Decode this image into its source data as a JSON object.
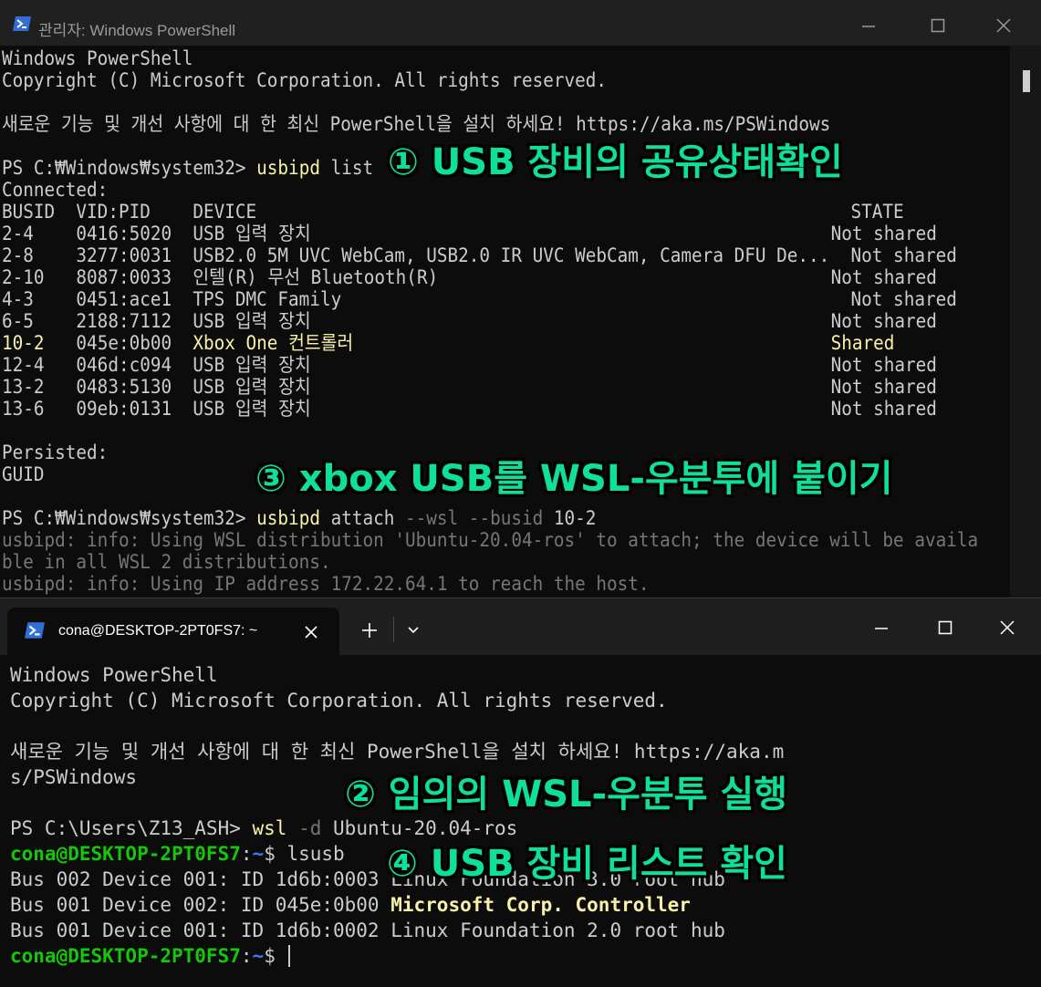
{
  "window1": {
    "title": "관리자: Windows PowerShell",
    "lines": [
      [
        {
          "t": "Windows PowerShell"
        }
      ],
      [
        {
          "t": "Copyright (C) Microsoft Corporation. All rights reserved."
        }
      ],
      [
        {
          "t": ""
        }
      ],
      [
        {
          "t": "새로운 기능 및 개선 사항에 대 한 최신 PowerShell을 설치 하세요! https://aka.ms/PSWindows"
        }
      ],
      [
        {
          "t": ""
        }
      ],
      [
        {
          "t": "PS C:₩Windows₩system32> "
        },
        {
          "t": "usbipd",
          "c": "yl"
        },
        {
          "t": " list"
        }
      ],
      [
        {
          "t": "Connected:"
        }
      ],
      [
        {
          "t": "BUSID  VID:PID    DEVICE                                                        STATE"
        }
      ],
      [
        {
          "t": "2-4    0416:5020  USB 입력 장치                                                 Not shared"
        }
      ],
      [
        {
          "t": "2-8    3277:0031  USB2.0 5M UVC WebCam, USB2.0 IR UVC WebCam, Camera DFU De...  Not shared"
        }
      ],
      [
        {
          "t": "2-10   8087:0033  인텔(R) 무선 Bluetooth(R)                                     Not shared"
        }
      ],
      [
        {
          "t": "4-3    0451:ace1  TPS DMC Family                                                Not shared"
        }
      ],
      [
        {
          "t": "6-5    2188:7112  USB 입력 장치                                                 Not shared"
        }
      ],
      [
        {
          "t": "10-2",
          "c": "yl"
        },
        {
          "t": "   045e:0b00  "
        },
        {
          "t": "Xbox One 컨트롤러                                             ",
          "c": "yl"
        },
        {
          "t": "Shared",
          "c": "yl"
        }
      ],
      [
        {
          "t": "12-4   046d:c094  USB 입력 장치                                                 Not shared"
        }
      ],
      [
        {
          "t": "13-2   0483:5130  USB 입력 장치                                                 Not shared"
        }
      ],
      [
        {
          "t": "13-6   09eb:0131  USB 입력 장치                                                 Not shared"
        }
      ],
      [
        {
          "t": ""
        }
      ],
      [
        {
          "t": "Persisted:"
        }
      ],
      [
        {
          "t": "GUID"
        }
      ],
      [
        {
          "t": ""
        }
      ],
      [
        {
          "t": "PS C:₩Windows₩system32> "
        },
        {
          "t": "usbipd",
          "c": "yl"
        },
        {
          "t": " attach "
        },
        {
          "t": "--wsl --busid",
          "c": "gr"
        },
        {
          "t": " 10-2"
        }
      ],
      [
        {
          "t": "usbipd: info: Using WSL distribution 'Ubuntu-20.04-ros' to attach; the device will be availa",
          "c": "gr"
        }
      ],
      [
        {
          "t": "ble in all WSL 2 distributions.",
          "c": "gr"
        }
      ],
      [
        {
          "t": "usbipd: info: Using IP address 172.22.64.1 to reach the host.",
          "c": "gr"
        }
      ]
    ]
  },
  "window2": {
    "tab_title": "cona@DESKTOP-2PT0FS7: ~",
    "lines": [
      [
        {
          "t": "Windows PowerShell"
        }
      ],
      [
        {
          "t": "Copyright (C) Microsoft Corporation. All rights reserved."
        }
      ],
      [
        {
          "t": ""
        }
      ],
      [
        {
          "t": "새로운 기능 및 개선 사항에 대 한 최신 PowerShell을 설치 하세요! https://aka.m"
        }
      ],
      [
        {
          "t": "s/PSWindows"
        }
      ],
      [
        {
          "t": ""
        }
      ],
      [
        {
          "t": "PS C:\\Users\\Z13_ASH> "
        },
        {
          "t": "wsl",
          "c": "yl"
        },
        {
          "t": " -d",
          "c": "gr"
        },
        {
          "t": " Ubuntu-20.04-ros"
        }
      ],
      [
        {
          "t": "cona@DESKTOP-2PT0FS7",
          "c": "gn"
        },
        {
          "t": ":"
        },
        {
          "t": "~",
          "c": "bl"
        },
        {
          "t": "$ lsusb"
        }
      ],
      [
        {
          "t": "Bus 002 Device 001: ID 1d6b:0003 Linux Foundation 3.0 root hub"
        }
      ],
      [
        {
          "t": "Bus 001 Device 002: ID 045e:0b00 "
        },
        {
          "t": "Microsoft Corp. Controller",
          "c": "yb"
        }
      ],
      [
        {
          "t": "Bus 001 Device 001: ID 1d6b:0002 Linux Foundation 2.0 root hub"
        }
      ],
      [
        {
          "t": "cona@DESKTOP-2PT0FS7",
          "c": "gn"
        },
        {
          "t": ":"
        },
        {
          "t": "~",
          "c": "bl"
        },
        {
          "t": "$ "
        }
      ]
    ]
  },
  "annotations": {
    "step1": "① USB 장비의 공유상태확인",
    "step2": "② 임의의 WSL-우분투 실행",
    "step3": "③ xbox USB를 WSL-우분투에 붙이기",
    "step4": "④ USB 장비 리스트 확인"
  },
  "colors": {
    "annotation": "#0fe098",
    "yellow": "#f9f1a5",
    "prompt_green": "#16c60c",
    "prompt_blue": "#3b78ff"
  }
}
